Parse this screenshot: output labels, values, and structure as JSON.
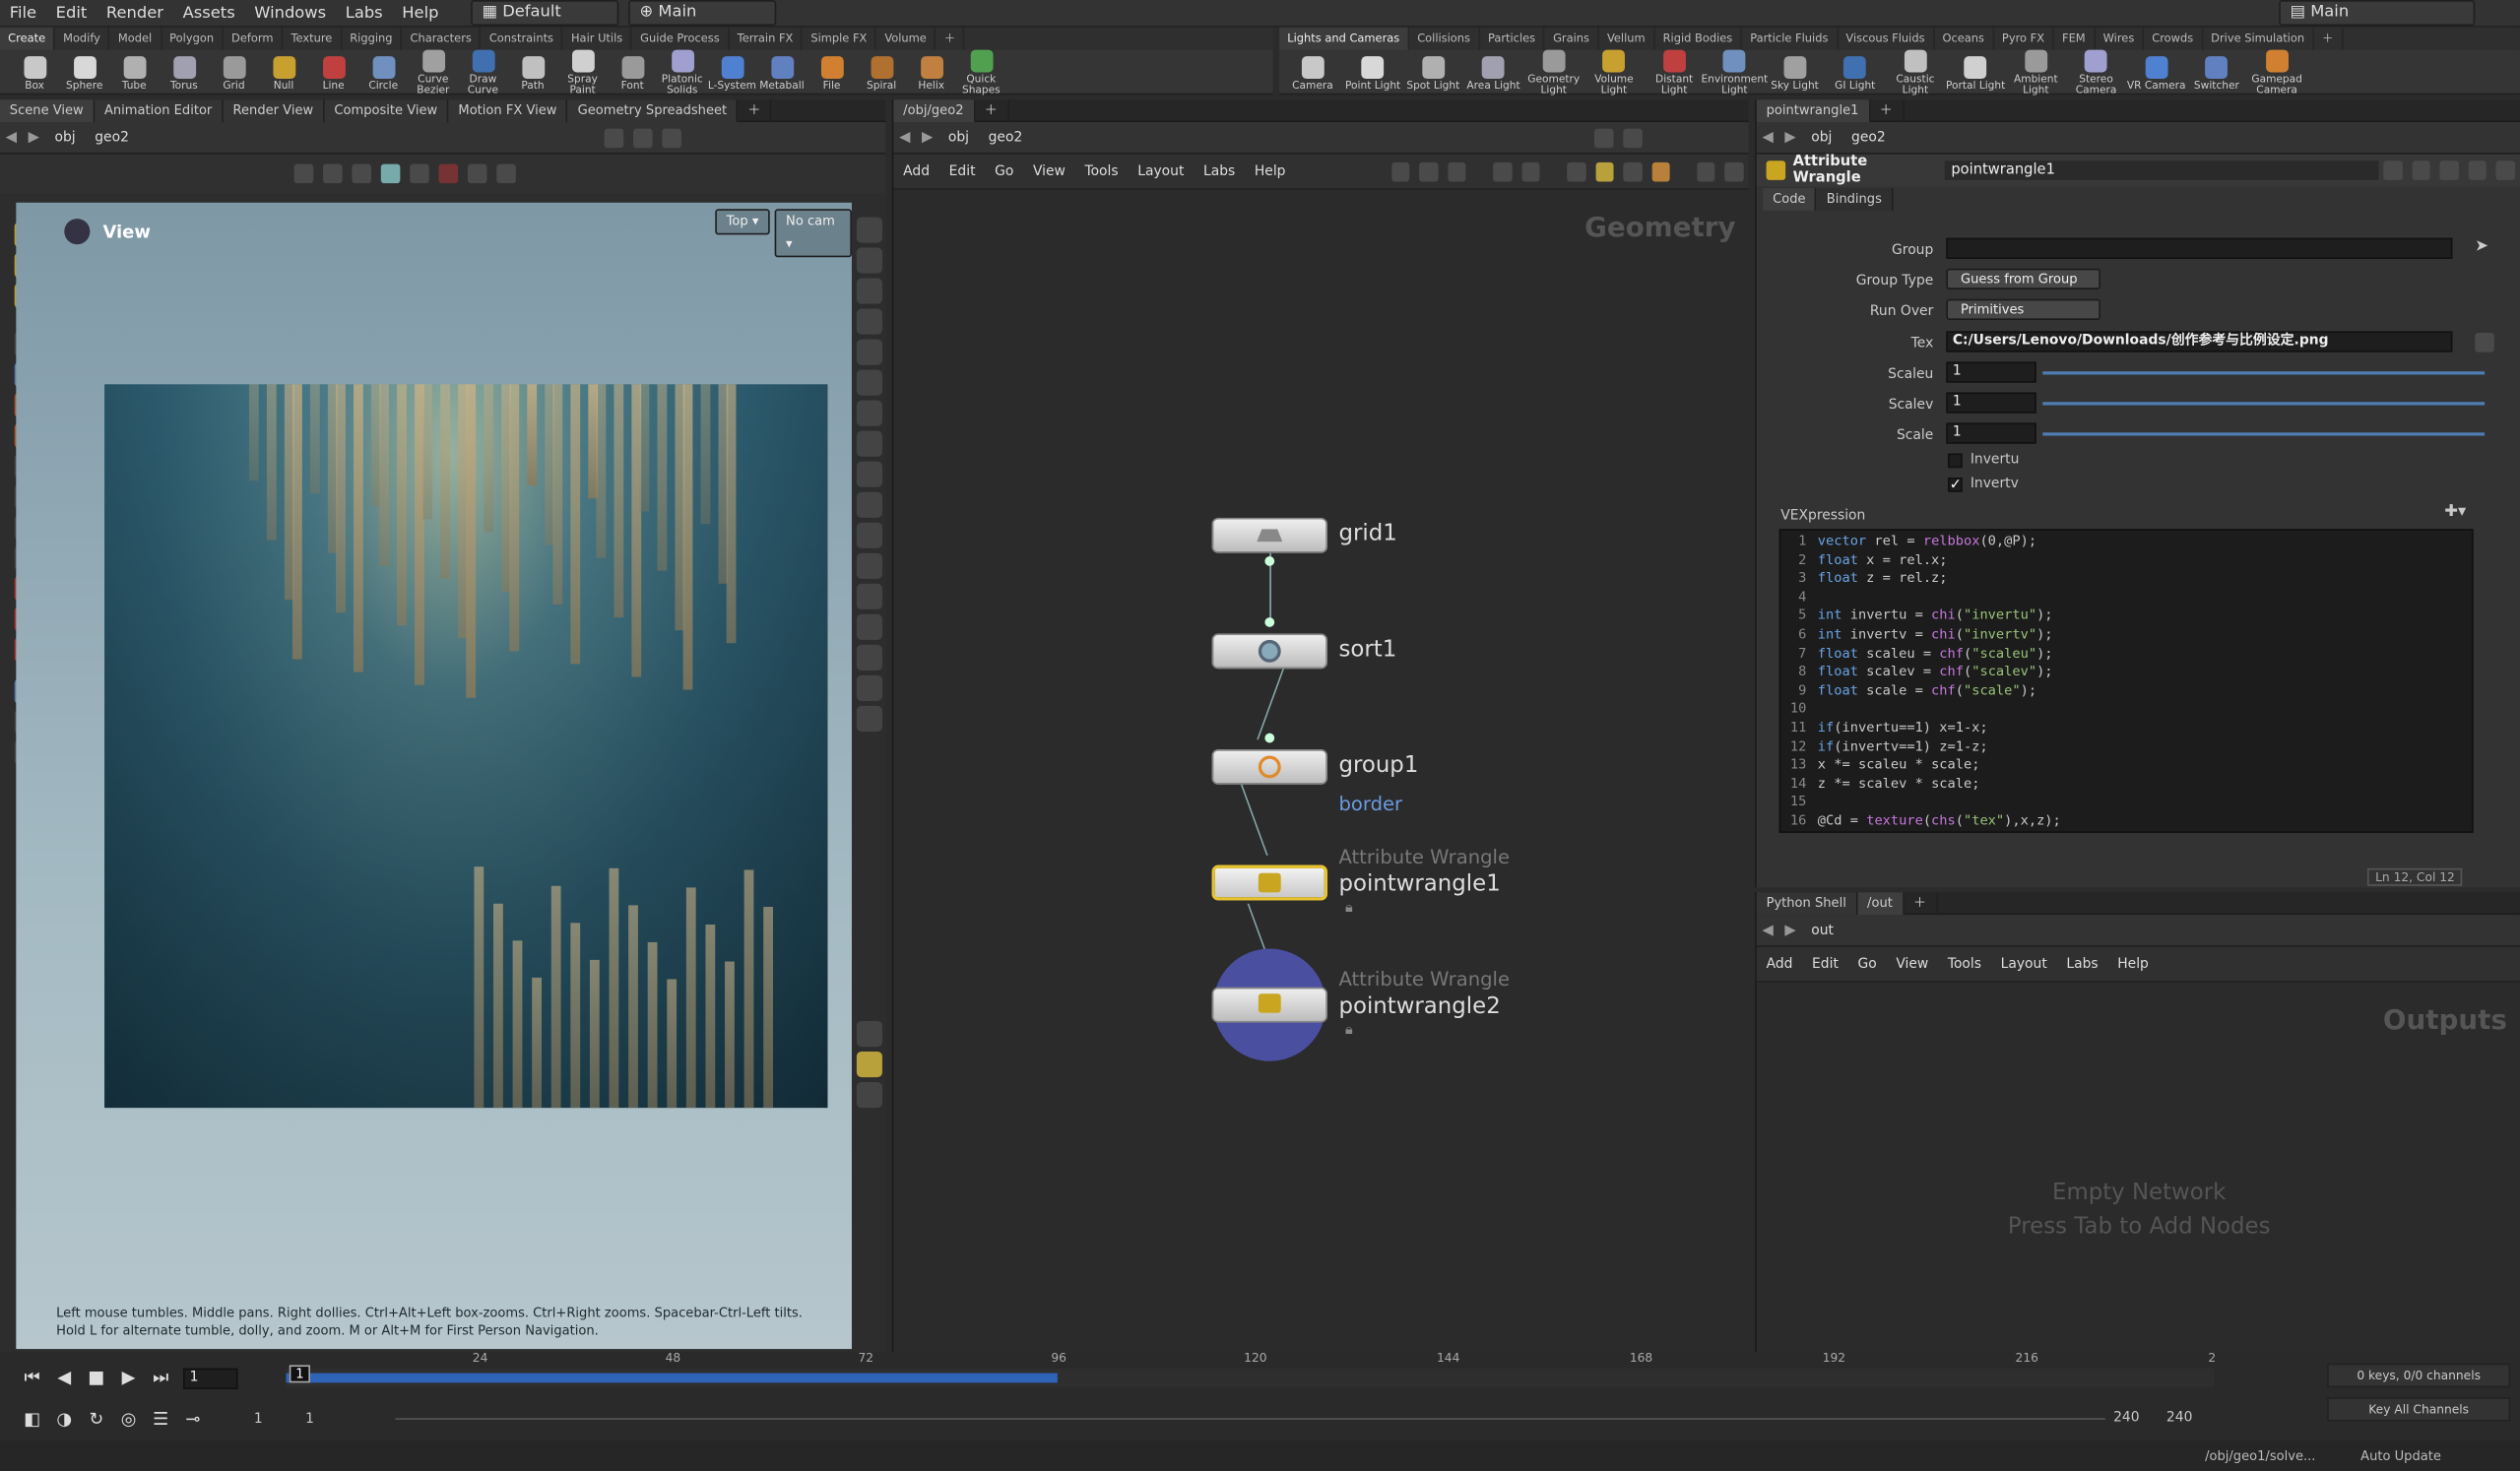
{
  "menubar": {
    "items": [
      "File",
      "Edit",
      "Render",
      "Assets",
      "Windows",
      "Labs",
      "Help"
    ],
    "desktop": "Default",
    "context": "Main",
    "right_context": "Main"
  },
  "shelf_left": {
    "tabs": [
      "Create",
      "Modify",
      "Model",
      "Polygon",
      "Deform",
      "Texture",
      "Rigging",
      "Characters",
      "Constraints",
      "Hair Utils",
      "Guide Process",
      "Terrain FX",
      "Simple FX",
      "Volume"
    ],
    "tools": [
      "Box",
      "Sphere",
      "Tube",
      "Torus",
      "Grid",
      "Null",
      "Line",
      "Circle",
      "Curve Bezier",
      "Draw Curve",
      "Path",
      "Spray Paint",
      "Font",
      "Platonic Solids",
      "L-System",
      "Metaball",
      "File",
      "Spiral",
      "Helix",
      "Quick Shapes"
    ]
  },
  "shelf_right": {
    "tabs": [
      "Lights and Cameras",
      "Collisions",
      "Particles",
      "Grains",
      "Vellum",
      "Rigid Bodies",
      "Particle Fluids",
      "Viscous Fluids",
      "Oceans",
      "Pyro FX",
      "FEM",
      "Wires",
      "Crowds",
      "Drive Simulation"
    ],
    "tools": [
      "Camera",
      "Point Light",
      "Spot Light",
      "Area Light",
      "Geometry Light",
      "Volume Light",
      "Distant Light",
      "Environment Light",
      "Sky Light",
      "GI Light",
      "Caustic Light",
      "Portal Light",
      "Ambient Light",
      "Stereo Camera",
      "VR Camera",
      "Switcher",
      "Gamepad Camera"
    ]
  },
  "left_pane": {
    "tabs": [
      "Scene View",
      "Animation Editor",
      "Render View",
      "Composite View",
      "Motion FX View",
      "Geometry Spreadsheet"
    ],
    "path": [
      "obj",
      "geo2"
    ],
    "view_label": "View",
    "top_btn": "Top",
    "cam_btn": "No cam",
    "hint": "Left mouse tumbles. Middle pans. Right dollies. Ctrl+Alt+Left box-zooms. Ctrl+Right zooms. Spacebar-Ctrl-Left tilts. Hold L for alternate tumble, dolly, and zoom. M or Alt+M for First Person Navigation."
  },
  "network": {
    "tab": "/obj/geo2",
    "path": [
      "obj",
      "geo2"
    ],
    "menu": [
      "Add",
      "Edit",
      "Go",
      "View",
      "Tools",
      "Layout",
      "Labs",
      "Help"
    ],
    "watermark": "Geometry",
    "nodes": [
      {
        "name": "grid1",
        "type": ""
      },
      {
        "name": "sort1",
        "type": ""
      },
      {
        "name": "group1",
        "type": "",
        "group_label": "border"
      },
      {
        "name": "pointwrangle1",
        "type": "Attribute Wrangle"
      },
      {
        "name": "pointwrangle2",
        "type": "Attribute Wrangle"
      }
    ]
  },
  "params": {
    "tab": "pointwrangle1",
    "path": [
      "obj",
      "geo2"
    ],
    "node_type": "Attribute Wrangle",
    "node_name": "pointwrangle1",
    "subtabs": [
      "Code",
      "Bindings"
    ],
    "group_label": "Group",
    "group_type_label": "Group Type",
    "group_type_value": "Guess from Group",
    "run_over_label": "Run Over",
    "run_over_value": "Primitives",
    "tex_label": "Tex",
    "tex_value": "C:/Users/Lenovo/Downloads/创作参考与比例设定.png",
    "scaleu_label": "Scaleu",
    "scaleu_value": "1",
    "scalev_label": "Scalev",
    "scalev_value": "1",
    "scale_label": "Scale",
    "scale_value": "1",
    "invertu_label": "Invertu",
    "invertv_label": "Invertv",
    "invertu_checked": false,
    "invertv_checked": true,
    "vex_label": "VEXpression",
    "status": "Ln 12, Col 12",
    "code": [
      "vector rel = relbbox(0,@P);",
      "float x = rel.x;",
      "float z = rel.z;",
      "",
      "int invertu = chi(\"invertu\");",
      "int invertv = chi(\"invertv\");",
      "float scaleu = chf(\"scaleu\");",
      "float scalev = chf(\"scalev\");",
      "float scale = chf(\"scale\");",
      "",
      "if(invertu==1) x=1-x;",
      "if(invertv==1) z=1-z;",
      "x *= scaleu * scale;",
      "z *= scalev * scale;",
      "",
      "@Cd = texture(chs(\"tex\"),x,z);"
    ]
  },
  "bottom_right": {
    "tabs": [
      "Python Shell",
      "/out"
    ],
    "path": "out",
    "menu": [
      "Add",
      "Edit",
      "Go",
      "View",
      "Tools",
      "Layout",
      "Labs",
      "Help"
    ],
    "watermark": "Outputs",
    "empty1": "Empty Network",
    "empty2": "Press Tab to Add Nodes"
  },
  "timeline": {
    "frame": "1",
    "current_marker": "1",
    "ticks": [
      "24",
      "48",
      "72",
      "96",
      "120",
      "144",
      "168",
      "192",
      "216",
      "2"
    ],
    "start": "1",
    "start2": "1",
    "end": "240",
    "end2": "240",
    "keys": "0 keys, 0/0 channels",
    "key_all": "Key All Channels",
    "status_path": "/obj/geo1/solve...",
    "auto_update": "Auto Update",
    "playbar_progress": 0.4
  }
}
